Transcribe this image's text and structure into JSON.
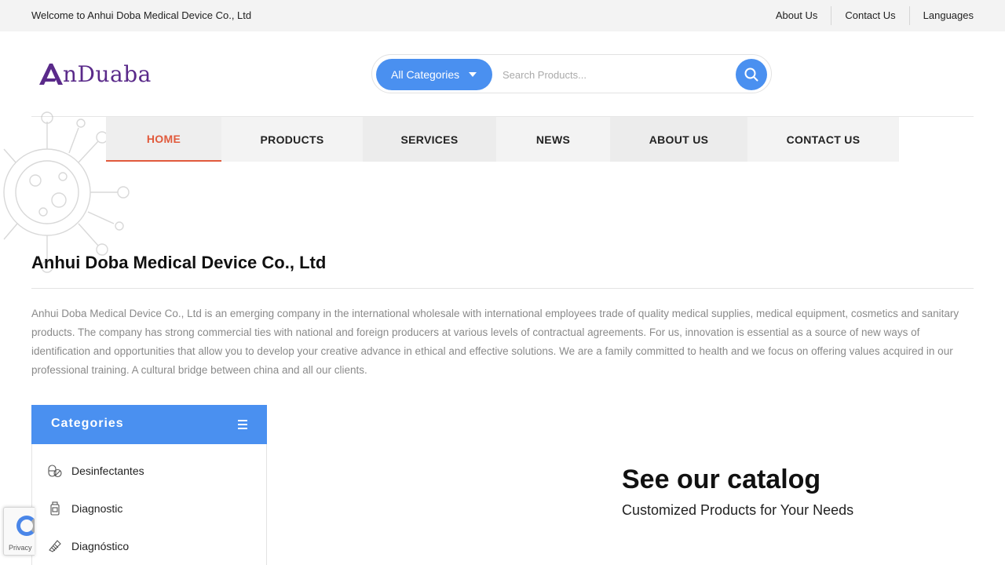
{
  "topbar": {
    "welcome": "Welcome to Anhui Doba Medical Device Co., Ltd",
    "links": [
      "About Us",
      "Contact Us",
      "Languages"
    ]
  },
  "logo": {
    "text": "nDuaba",
    "icon": "logo-a-mark"
  },
  "search": {
    "category_label": "All Categories",
    "placeholder": "Search Products...",
    "button_icon": "search-icon"
  },
  "nav": {
    "items": [
      "HOME",
      "PRODUCTS",
      "SERVICES",
      "NEWS",
      "ABOUT US",
      "CONTACT US"
    ],
    "active": "HOME"
  },
  "company": {
    "title": "Anhui Doba Medical Device Co., Ltd",
    "description": "Anhui Doba Medical Device Co., Ltd is an emerging company in the international wholesale with international employees trade of quality medical supplies, medical equipment, cosmetics and sanitary products. The company has strong commercial ties with national and foreign producers at various levels of contractual agreements. For us, innovation is essential as a source of new ways of identification and opportunities that allow you to develop your creative advance in ethical and effective solutions. We are a family committed to health and we focus on offering values acquired in our professional training. A cultural bridge between china and all our clients."
  },
  "categories": {
    "title": "Categories",
    "items": [
      {
        "label": "Desinfectantes",
        "icon": "pills-icon"
      },
      {
        "label": "Diagnostic",
        "icon": "bottle-icon"
      },
      {
        "label": "Diagnóstico",
        "icon": "bandage-icon"
      }
    ]
  },
  "catalog": {
    "title": "See our catalog",
    "subtitle": "Customized Products for Your Needs"
  },
  "recaptcha": {
    "privacy": "Privacy"
  },
  "colors": {
    "accent": "#4a90f0",
    "active_nav": "#e15a3c",
    "logo": "#5a2a8a"
  }
}
